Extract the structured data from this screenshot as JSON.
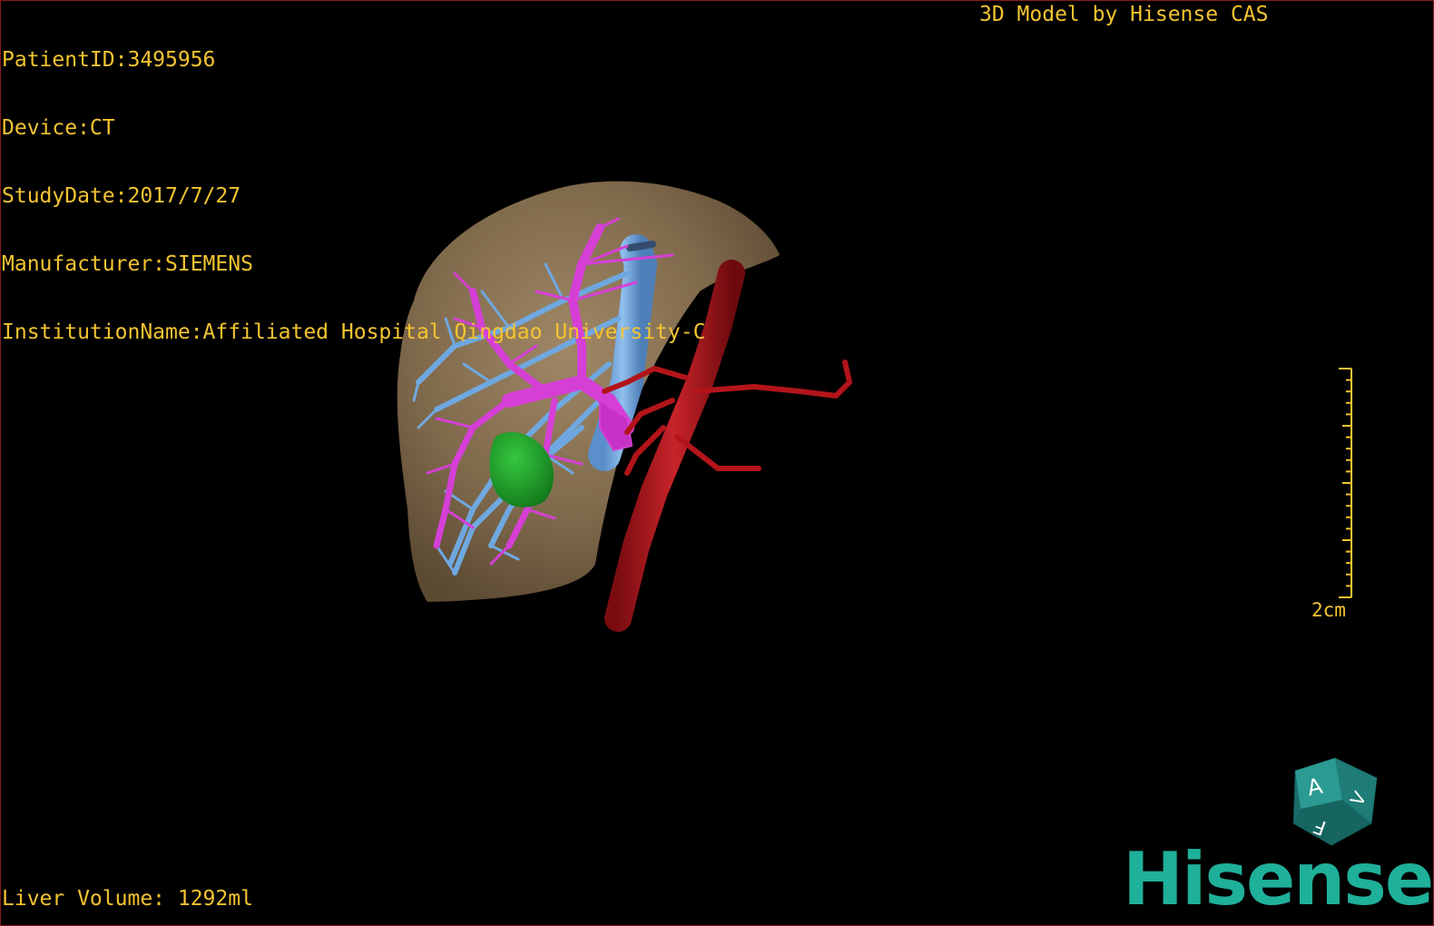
{
  "dicom_info": {
    "patient_id": "PatientID:3495956",
    "device": "Device:CT",
    "study_date": "StudyDate:2017/7/27",
    "manufacturer": "Manufacturer:SIEMENS",
    "institution": "InstitutionName:Affiliated Hospital Qingdao University-C"
  },
  "model_credit": "3D Model by Hisense CAS",
  "liver_volume": "Liver Volume: 1292ml",
  "scale_bar": {
    "label": "2cm"
  },
  "orientation_cube": {
    "labels": [
      "A",
      "F",
      "V"
    ]
  },
  "brand": "Hisense",
  "colors": {
    "overlay_text": "#f4c430",
    "liver": "#8b7355",
    "portal_vein": "#d63fd6",
    "hepatic_vein": "#6fa8e0",
    "artery": "#b3141a",
    "lesion": "#1f9e2a",
    "brand": "#1fb09a",
    "border": "#8a1a1a"
  }
}
